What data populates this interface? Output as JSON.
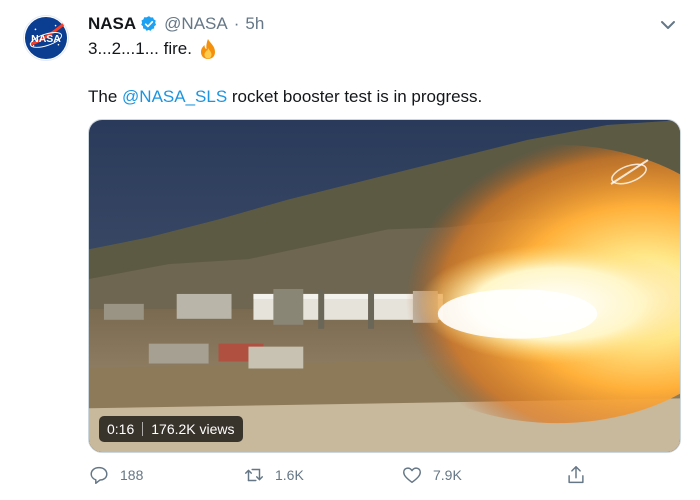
{
  "tweet": {
    "author_name": "NASA",
    "handle": "@NASA",
    "separator": "·",
    "time": "5h",
    "line1": "3...2...1... fire.",
    "text_before": "The ",
    "mention": "@NASA_SLS",
    "text_after": " rocket booster test is in progress."
  },
  "avatar": {
    "label": "NASA"
  },
  "video": {
    "duration": "0:16",
    "views": "176.2K views"
  },
  "actions": {
    "replies": "188",
    "retweets": "1.6K",
    "likes": "7.9K"
  },
  "icons": {
    "verified": "verified-badge-icon",
    "caret": "chevron-down-icon",
    "fire": "fire-emoji-icon",
    "reply": "reply-icon",
    "retweet": "retweet-icon",
    "like": "heart-icon",
    "share": "share-icon"
  },
  "colors": {
    "link": "#1b95e0",
    "muted": "#657786",
    "text": "#14171a",
    "verified": "#1da1f2"
  }
}
